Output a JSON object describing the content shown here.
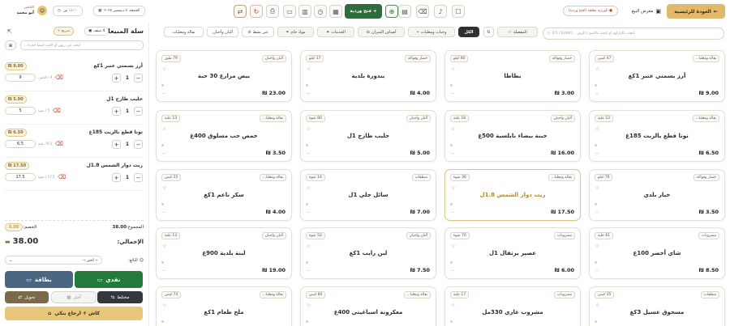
{
  "header": {
    "back_button": "العودة للرئيسية",
    "store_label": "معرض البيع",
    "store_badge": "● الوردية مغلقة (افتح وردية)",
    "open_shift_button": "فتح وردية",
    "datetime": "الجمعة، ٥ ديسمبر ٢٠٢٥",
    "time": "١١:٠٠ ص",
    "user_role": "الكاشير",
    "user_name": "أبو محمد"
  },
  "search": {
    "placeholder": "ابحث بالباركود أو ابحث بالاسم / الرمز... (F1 / Enter)"
  },
  "tabs": [
    {
      "label": "الكل",
      "active": true
    },
    {
      "label": "وجبات ومعلبات"
    },
    {
      "label": "أصناف الميزان"
    },
    {
      "label": "الخدمات"
    },
    {
      "label": "مواد خام"
    },
    {
      "label": "غير نشط"
    },
    {
      "label": "ألبان وأجبان"
    },
    {
      "label": "بقالة ومعلبات"
    },
    {
      "label": "المفضلة"
    }
  ],
  "products": [
    {
      "name": "أرز بسمتي عنبر 1كغ",
      "cat": "بقالة ومعلبا...",
      "stock": "47 كيس",
      "price": "9.00 ₪"
    },
    {
      "name": "بطاطا",
      "cat": "خضار وفواكه",
      "stock": "80 كيلو",
      "price": "3.00 ₪"
    },
    {
      "name": "بندورة بلدية",
      "cat": "خضار وفواكه",
      "stock": "17 كيلو",
      "price": "4.00 ₪"
    },
    {
      "name": "بيض مزارع 30 حبة",
      "cat": "ألبان وأجبان",
      "stock": "79 طبق",
      "price": "23.00 ₪"
    },
    {
      "name": "تونا قطع بالزيت 185غ",
      "cat": "بقالة ومعلبا...",
      "stock": "12 علبة",
      "price": "6.50 ₪"
    },
    {
      "name": "جبنة بيضاء نابلسية 500غ",
      "cat": "ألبان وأجبان",
      "stock": "18 علبة",
      "price": "16.00 ₪"
    },
    {
      "name": "حليب طازج 1ل",
      "cat": "ألبان وأجبان",
      "stock": "80 عبوة",
      "price": "5.00 ₪"
    },
    {
      "name": "حمص حب مسلوق 400غ",
      "cat": "بقالة ومعلبا...",
      "stock": "13 علبة",
      "price": "3.50 ₪"
    },
    {
      "name": "خيار بلدي",
      "cat": "خضار وفواكه",
      "stock": "76 كيلو",
      "price": "3.50 ₪"
    },
    {
      "name": "زيت دوار الشمس 1.8ل",
      "cat": "بقالة ومعلبا...",
      "stock": "36 عبوة",
      "price": "17.50 ₪"
    },
    {
      "name": "سائل جلي 1ل",
      "cat": "منظفات",
      "stock": "14 عبوة",
      "price": "7.00 ₪"
    },
    {
      "name": "سكر ناعم 1كغ",
      "cat": "بقالة ومعلبا...",
      "stock": "25 كيس",
      "price": "4.00 ₪"
    },
    {
      "name": "شاي أخضر 100غ",
      "cat": "مشروبات",
      "stock": "61 علبة",
      "price": "8.50 ₪"
    },
    {
      "name": "عصير برتقال 1ل",
      "cat": "مشروبات",
      "stock": "70 عبوة",
      "price": "6.00 ₪"
    },
    {
      "name": "لبن رايب 1كغ",
      "cat": "ألبان وأجبان",
      "stock": "52 عبوة",
      "price": "7.50 ₪"
    },
    {
      "name": "لبنة بلدية 900غ",
      "cat": "ألبان وأجبان",
      "stock": "13 علبة",
      "price": "19.00 ₪"
    },
    {
      "name": "مسحوق غسيل 3كغ",
      "cat": "منظفات",
      "stock": "35 كيس",
      "price": ""
    },
    {
      "name": "مشروب غازي 330مل",
      "cat": "مشروبات",
      "stock": "17 علبة",
      "price": ""
    },
    {
      "name": "معكرونة اسباغيتي 400غ",
      "cat": "بقالة ومعلبا...",
      "stock": "80 كيس",
      "price": ""
    },
    {
      "name": "ملح طعام 1كغ",
      "cat": "بقالة ومعلبا...",
      "stock": "74 كيس",
      "price": ""
    }
  ],
  "cart": {
    "title": "سلة المبيعات",
    "count_badge": "4 صنف",
    "quick_button": "سريع",
    "customer_placeholder": "ابحث عن زبون أو اكتب اسما جديدا...",
    "items": [
      {
        "name": "أرز بسمتي عنبر 1كغ",
        "price": "9.00 ₪",
        "qty": "1",
        "input": "9",
        "unit_label": "9 / الكيس"
      },
      {
        "name": "حليب طازج 1ل",
        "price": "5.00 ₪",
        "qty": "1",
        "input": "5",
        "unit_label": "5 / عبوة"
      },
      {
        "name": "تونا قطع بالزيت 185غ",
        "price": "6.50 ₪",
        "qty": "1",
        "input": "6.5",
        "unit_label": "6.5 / علبة"
      },
      {
        "name": "زيت دوار الشمس 1.8ل",
        "price": "17.50 ₪",
        "qty": "1",
        "input": "17.5",
        "unit_label": "17.5 / عبوة"
      }
    ],
    "subtotal_label": "المجموع:",
    "subtotal": "38.00",
    "discount_label": "الخصم:",
    "discount": "0.00",
    "total_label": "الإجمالي:",
    "total": "38.00",
    "seller_label": "البائع:",
    "seller_value": "-- اختر --",
    "pay_cash": "نقدي",
    "pay_card": "بطاقة",
    "pay_mixed": "مختلط",
    "pay_later": "آجل",
    "pay_transfer": "تحويل",
    "cash_return": "كاش + ارجاع بنكي"
  }
}
